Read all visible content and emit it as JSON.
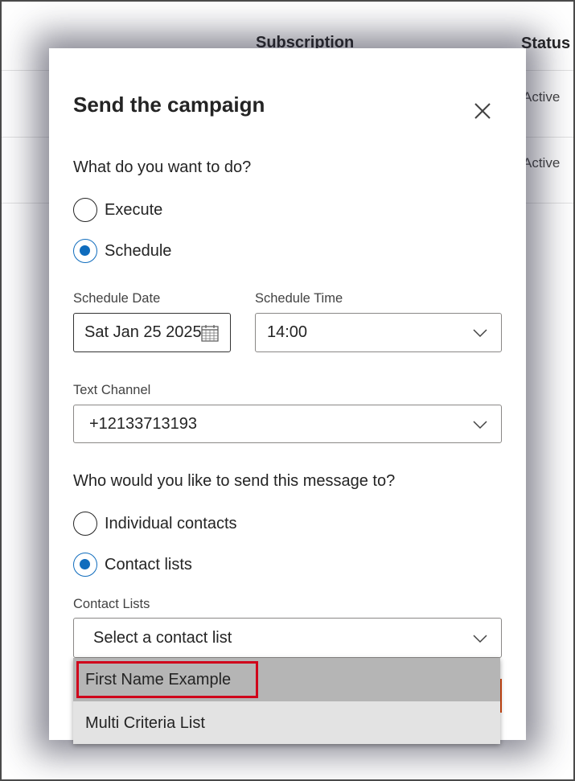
{
  "background_table": {
    "col_subscription": "Subscription",
    "col_status": "Status",
    "rows": [
      {
        "status": "Active"
      },
      {
        "status": "Active"
      }
    ]
  },
  "dialog": {
    "title": "Send the campaign",
    "action_question": "What do you want to do?",
    "action_options": [
      {
        "label": "Execute",
        "checked": false
      },
      {
        "label": "Schedule",
        "checked": true
      }
    ],
    "schedule_date_label": "Schedule Date",
    "schedule_date_value": "Sat Jan 25 2025",
    "schedule_time_label": "Schedule Time",
    "schedule_time_value": "14:00",
    "text_channel_label": "Text Channel",
    "text_channel_value": "+12133713193",
    "recipient_question": "Who would you like to send this message to?",
    "recipient_options": [
      {
        "label": "Individual contacts",
        "checked": false
      },
      {
        "label": "Contact lists",
        "checked": true
      }
    ],
    "contact_lists_label": "Contact Lists",
    "contact_lists_placeholder": "Select a contact list",
    "contact_list_options": [
      {
        "label": "First Name Example",
        "hovered": true
      },
      {
        "label": "Multi Criteria List",
        "hovered": false
      }
    ]
  },
  "colors": {
    "accent": "#0f6cbd",
    "highlight": "#d0021b",
    "hover_option": "#b5b5b5"
  },
  "icons": {
    "close": "close-icon",
    "calendar": "calendar-icon",
    "chevron": "chevron-down-icon"
  }
}
